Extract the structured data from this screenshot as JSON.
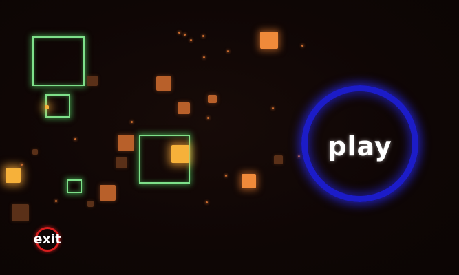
{
  "menu": {
    "play_label": "play",
    "exit_label": "exit"
  },
  "colors": {
    "background": "#0f0605",
    "green_outline": "#7ee08a",
    "orange_square": "#f08a3a",
    "play_ring": "#1c1cc8",
    "exit_ring": "#d81e1e"
  },
  "icons": {
    "play": "play-ring-icon",
    "exit": "exit-ring-icon"
  }
}
